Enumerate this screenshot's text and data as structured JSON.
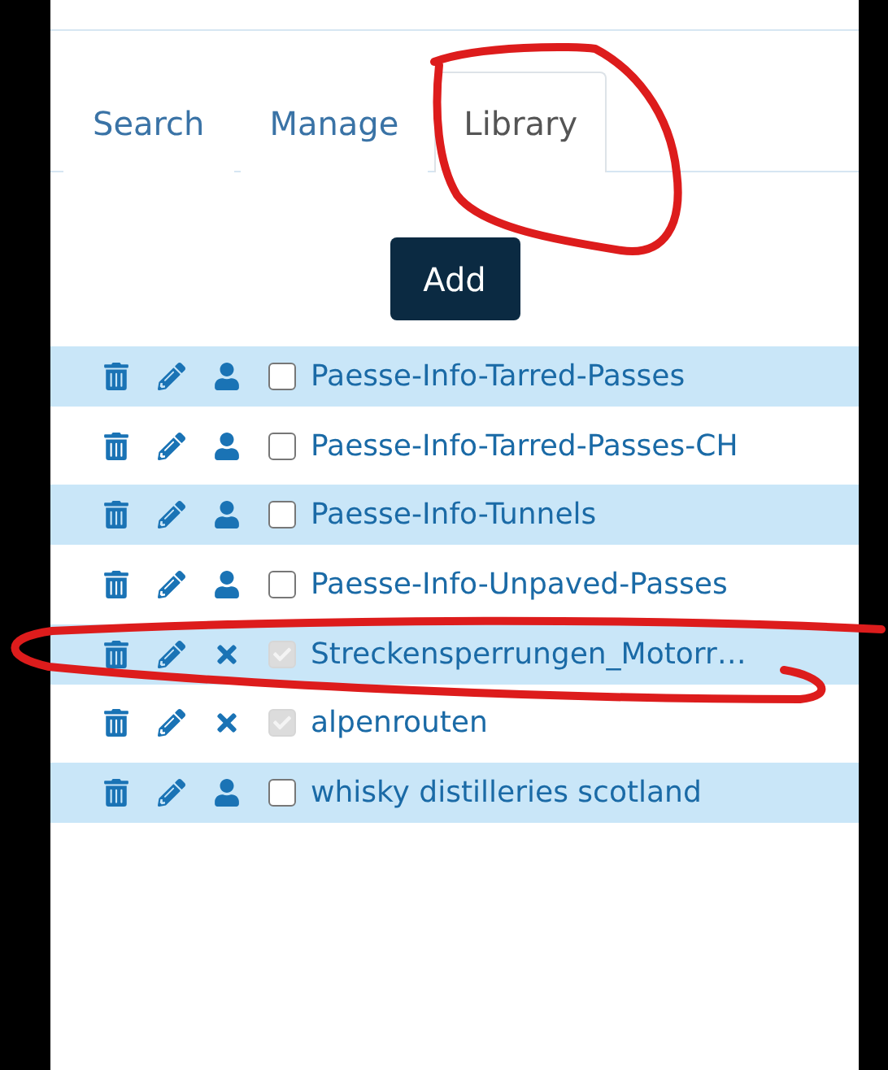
{
  "tabs": [
    {
      "label": "Search",
      "selected": false
    },
    {
      "label": "Manage",
      "selected": false
    },
    {
      "label": "Library",
      "selected": true
    }
  ],
  "add_button": "Add",
  "rows": [
    {
      "name": "Paesse-Info-Tarred-Passes",
      "kind": "person",
      "checked": false,
      "disabled": false
    },
    {
      "name": "Paesse-Info-Tarred-Passes-CH",
      "kind": "person",
      "checked": false,
      "disabled": false
    },
    {
      "name": "Paesse-Info-Tunnels",
      "kind": "person",
      "checked": false,
      "disabled": false
    },
    {
      "name": "Paesse-Info-Unpaved-Passes",
      "kind": "person",
      "checked": false,
      "disabled": false
    },
    {
      "name": "Streckensperrungen_Motorr…",
      "kind": "remove",
      "checked": true,
      "disabled": true
    },
    {
      "name": "alpenrouten",
      "kind": "remove",
      "checked": true,
      "disabled": true
    },
    {
      "name": "whisky distilleries scotland",
      "kind": "person",
      "checked": false,
      "disabled": false
    }
  ]
}
